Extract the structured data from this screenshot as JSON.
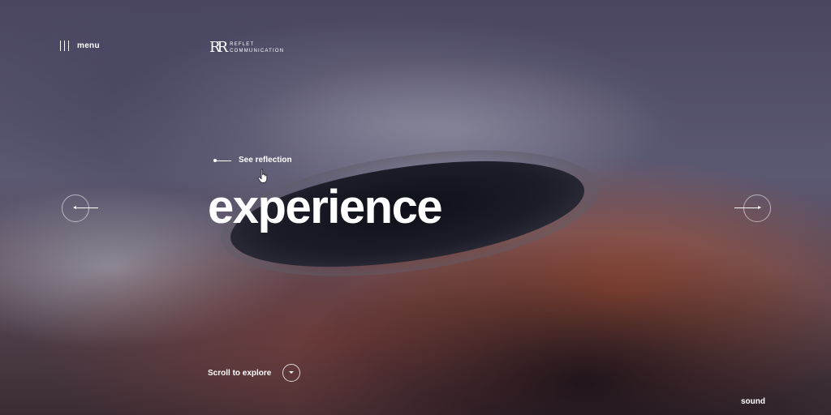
{
  "nav": {
    "menu_label": "menu",
    "menu_icon": "vertical-bars-icon"
  },
  "brand": {
    "mark": "RR",
    "line1": "REFLET",
    "line2": "COMMUNICATION"
  },
  "hero": {
    "see_label": "See reflection",
    "headline": "experience",
    "prev_icon": "arrow-left-icon",
    "next_icon": "arrow-right-icon",
    "pointer_icon": "hand-pointer-icon"
  },
  "footer": {
    "scroll_label": "Scroll to explore",
    "scroll_icon": "chevron-down-icon",
    "sound_label": "sound"
  },
  "colors": {
    "text": "#ffffff",
    "crater_dark": "#0e0f18",
    "rust": "#b05434"
  }
}
